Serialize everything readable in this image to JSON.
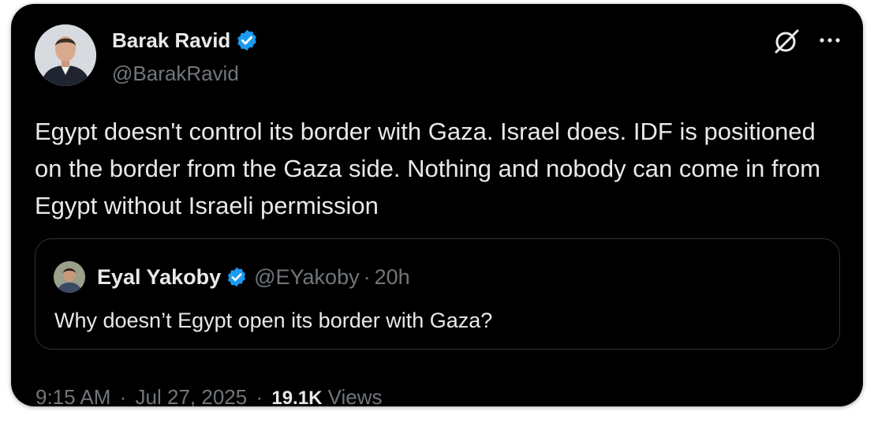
{
  "tweet": {
    "author": {
      "name": "Barak Ravid",
      "handle": "@BarakRavid",
      "verified": true
    },
    "text": "Egypt doesn't control its border with Gaza. Israel does. IDF is positioned on the border from the Gaza side. Nothing and nobody can come in from Egypt without Israeli permission",
    "quoted": {
      "name": "Eyal Yakoby",
      "handle": "@EYakoby",
      "separator": "·",
      "time": "20h",
      "text": "Why doesn’t Egypt open its border with Gaza?"
    },
    "meta": {
      "time": "9:15 AM",
      "separator": "·",
      "date": "Jul 27, 2025",
      "views_count": "19.1K",
      "views_label": "Views"
    }
  },
  "colors": {
    "background": "#000000",
    "text_primary": "#e7e9ea",
    "text_secondary": "#71767b",
    "verified_blue": "#1d9bf0",
    "border": "#2f3336"
  },
  "icons": [
    "verified-badge-icon",
    "grok-icon",
    "more-options-icon"
  ]
}
